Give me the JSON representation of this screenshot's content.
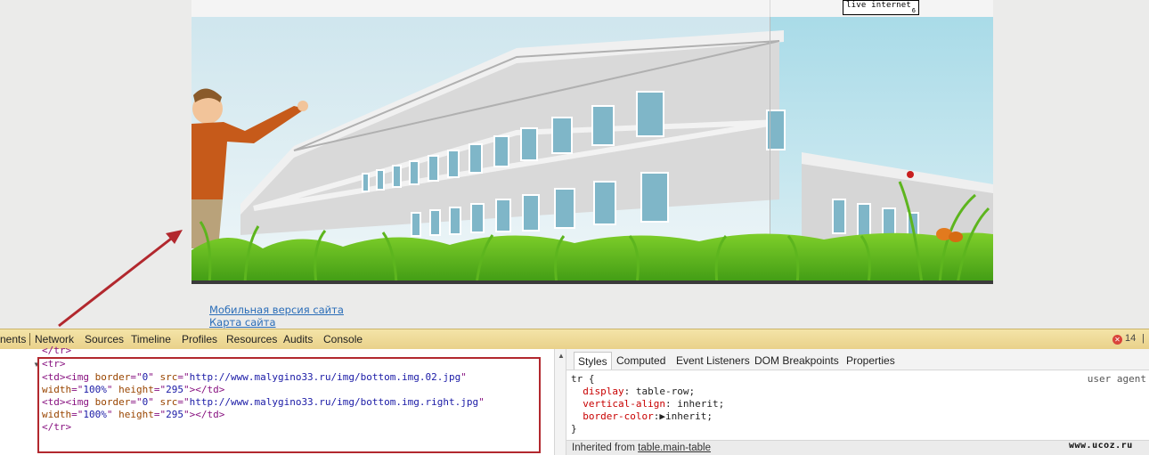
{
  "counter": {
    "brand": "live internet",
    "digit": "6"
  },
  "footer": {
    "mobile_link": "Мобильная версия сайта",
    "sitemap_link": "Карта сайта"
  },
  "devtools": {
    "tabs": [
      "nents",
      "Network",
      "Sources",
      "Timeline",
      "Profiles",
      "Resources",
      "Audits",
      "Console"
    ],
    "error_count": "14",
    "elements": {
      "lines": [
        {
          "tag1": "</tr>"
        },
        {
          "tag1": "<tr>"
        },
        {
          "tag1": "<td><img ",
          "attr1": "border",
          "eq1": "=\"",
          "val1": "0",
          "q1": "\" ",
          "attr2": "src",
          "eq2": "=\"",
          "val2": "http://www.malygino33.ru/img/bottom.img.02.jpg",
          "q2": "\""
        },
        {
          "attr1": "width",
          "eq1": "=\"",
          "val1": "100%",
          "q1": "\" ",
          "attr2": "height",
          "eq2": "=\"",
          "val2": "295",
          "q2": "\">",
          "tag2": "</td>"
        },
        {
          "tag1": "<td><img ",
          "attr1": "border",
          "eq1": "=\"",
          "val1": "0",
          "q1": "\" ",
          "attr2": "src",
          "eq2": "=\"",
          "val2": "http://www.malygino33.ru/img/bottom.img.right.jpg",
          "q2": "\""
        },
        {
          "attr1": "width",
          "eq1": "=\"",
          "val1": "100%",
          "q1": "\" ",
          "attr2": "height",
          "eq2": "=\"",
          "val2": "295",
          "q2": "\">",
          "tag2": "</td>"
        },
        {
          "tag1": "</tr>"
        }
      ]
    },
    "styles": {
      "tabs": [
        "Styles",
        "Computed",
        "Event Listeners",
        "DOM Breakpoints",
        "Properties"
      ],
      "selector": "tr {",
      "user_agent": "user agent",
      "props": [
        {
          "name": "display",
          "value": "table-row;"
        },
        {
          "name": "vertical-align",
          "value": "inherit;"
        },
        {
          "name": "border-color",
          "value": "inherit;"
        }
      ],
      "close": "}",
      "inherited_prefix": "Inherited from ",
      "inherited_link": "table.main-table"
    }
  },
  "watermark": "www.ucoz.ru",
  "colors": {
    "annotation_red": "#b2282e",
    "link_blue": "#2a6db8",
    "devtools_bar": "#efdc9a"
  }
}
